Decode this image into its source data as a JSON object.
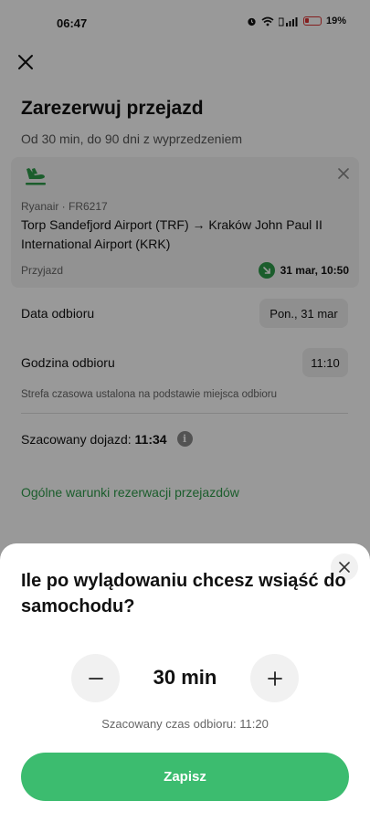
{
  "status_bar": {
    "time": "06:47",
    "battery": "19%"
  },
  "header": {
    "title": "Zarezerwuj przejazd",
    "subtitle": "Od 30 min, do 90 dni z wyprzedzeniem"
  },
  "flight": {
    "airline": "Ryanair · FR6217",
    "route": "Torp Sandefjord Airport (TRF) → Kraków John Paul II International Airport (KRK)",
    "arrival_label": "Przyjazd",
    "arrival_datetime": "31 mar, 10:50"
  },
  "pickup": {
    "date_label": "Data odbioru",
    "date_value": "Pon., 31 mar",
    "time_label": "Godzina odbioru",
    "time_value": "11:10",
    "timezone_note": "Strefa czasowa ustalona na podstawie miejsca odbioru",
    "eta_label": "Szacowany dojazd: ",
    "eta_value": "11:34",
    "terms_link": "Ogólne warunki rezerwacji przejazdów"
  },
  "sheet": {
    "title": "Ile po wylądowaniu chcesz wsiąść do samochodu?",
    "stepper_value": "30 min",
    "estimated_pickup": "Szacowany czas odbioru: 11:20",
    "save_label": "Zapisz"
  },
  "colors": {
    "accent": "#3cbc6f",
    "link": "#2d9c4a"
  },
  "icons": [
    "close-icon",
    "airplane-landing-icon",
    "arrow-down-right-icon",
    "info-icon",
    "minus-icon",
    "plus-icon"
  ]
}
